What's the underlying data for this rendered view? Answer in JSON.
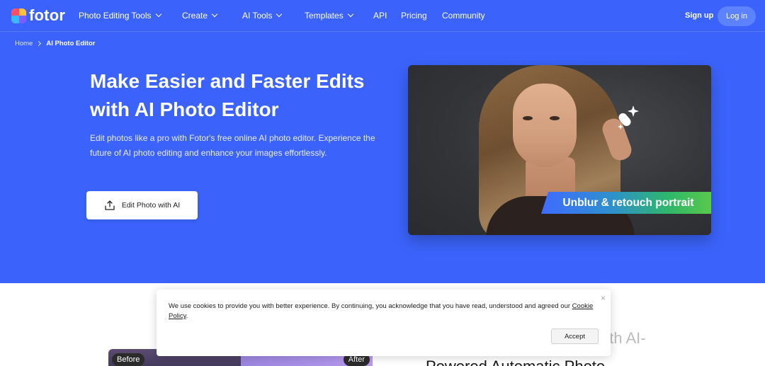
{
  "colors": {
    "brand": "#3b63fb",
    "login_bg": "#5c82ff"
  },
  "nav": {
    "logo_text": "fotor",
    "items": [
      {
        "label": "Photo Editing Tools",
        "dropdown": true
      },
      {
        "label": "Create",
        "dropdown": true
      },
      {
        "label": "AI Tools",
        "dropdown": true
      },
      {
        "label": "Templates",
        "dropdown": true
      },
      {
        "label": "API",
        "dropdown": false
      },
      {
        "label": "Pricing",
        "dropdown": false
      },
      {
        "label": "Community",
        "dropdown": false
      }
    ],
    "signup": "Sign up",
    "login": "Log in"
  },
  "breadcrumb": {
    "home": "Home",
    "current": "AI Photo Editor"
  },
  "hero": {
    "title": "Make Easier and Faster Edits with AI Photo Editor",
    "description": "Edit photos like a pro with Fotor's free online AI photo editor. Experience the future of AI photo editing and enhance your images effortlessly.",
    "cta": "Edit Photo with AI",
    "image_banner": "Unblur & retouch portrait"
  },
  "comparison": {
    "before": "Before",
    "after": "After"
  },
  "section_heading": {
    "faded": "Unlock Editing Potential with AI-",
    "main": "Powered Automatic Photo"
  },
  "cookie": {
    "text": "We use cookies to provide you with better experience. By continuing, you acknowledge that you have read, understood and agreed our",
    "link": "Cookie Policy",
    "end": ".",
    "accept": "Accept",
    "close": "×"
  }
}
